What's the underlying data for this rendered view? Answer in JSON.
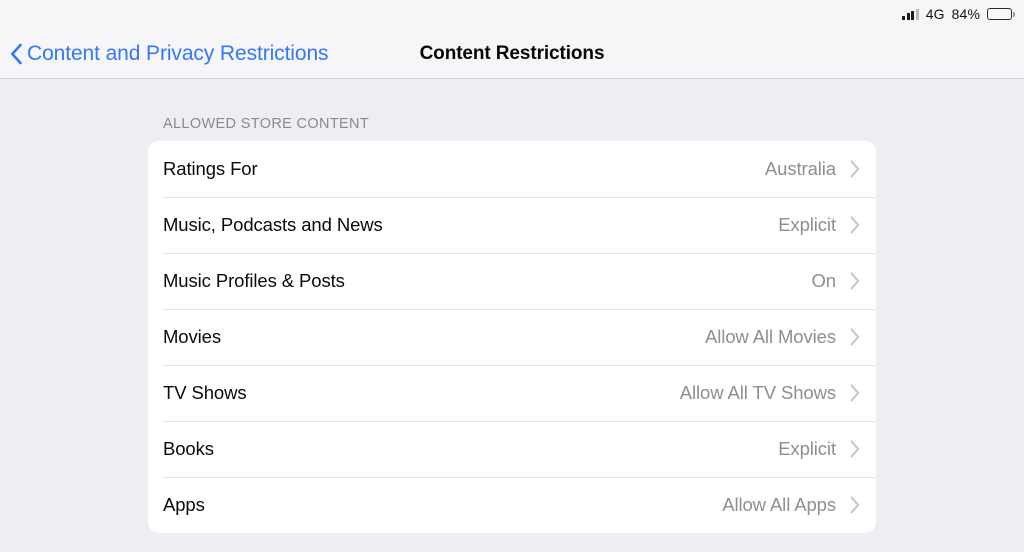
{
  "status_bar": {
    "network": "4G",
    "battery_percent": "84%",
    "signal_icon": "signal-bars-icon",
    "battery_icon": "battery-icon",
    "signal_bars_total": 4,
    "signal_bars_filled": 3,
    "battery_level": 84
  },
  "nav": {
    "back_label": "Content and Privacy Restrictions",
    "back_icon": "chevron-left-icon",
    "title": "Content Restrictions"
  },
  "section": {
    "header": "ALLOWED STORE CONTENT",
    "rows": [
      {
        "label": "Ratings For",
        "value": "Australia",
        "icon": "chevron-right-icon"
      },
      {
        "label": "Music, Podcasts and News",
        "value": "Explicit",
        "icon": "chevron-right-icon"
      },
      {
        "label": "Music Profiles & Posts",
        "value": "On",
        "icon": "chevron-right-icon"
      },
      {
        "label": "Movies",
        "value": "Allow All Movies",
        "icon": "chevron-right-icon"
      },
      {
        "label": "TV Shows",
        "value": "Allow All TV Shows",
        "icon": "chevron-right-icon"
      },
      {
        "label": "Books",
        "value": "Explicit",
        "icon": "chevron-right-icon"
      },
      {
        "label": "Apps",
        "value": "Allow All Apps",
        "icon": "chevron-right-icon"
      }
    ]
  },
  "colors": {
    "accent_blue": "#3478f6",
    "page_background": "#eeeef2",
    "bar_background": "#f6f6f8",
    "card_background": "#ffffff",
    "value_gray": "#8e8e93",
    "header_gray": "#898992",
    "separator": "#e3e3e6"
  }
}
